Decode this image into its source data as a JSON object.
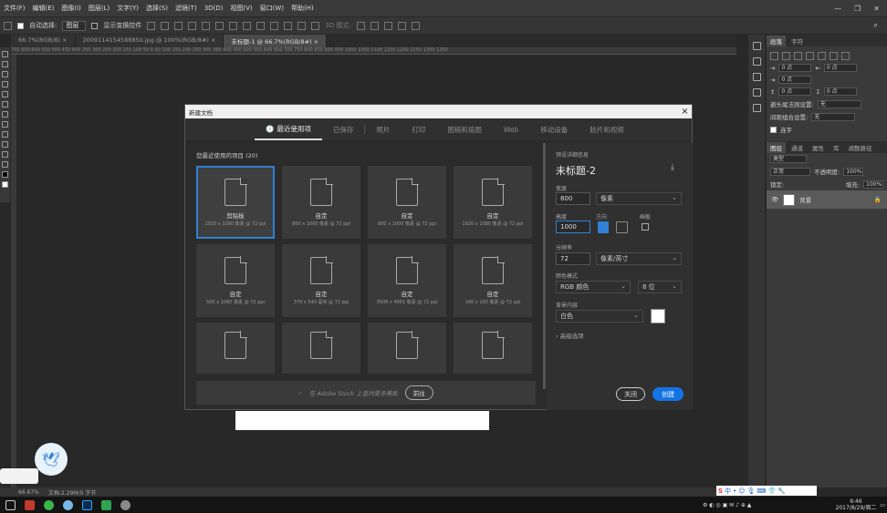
{
  "menu": [
    "文件(F)",
    "编辑(E)",
    "图像(I)",
    "图层(L)",
    "文字(Y)",
    "选择(S)",
    "滤镜(T)",
    "3D(D)",
    "视图(V)",
    "窗口(W)",
    "帮助(H)"
  ],
  "options": {
    "auto_select": "自动选择:",
    "layer_select": "图层",
    "show_transform": "显示变换控件",
    "mode3d": "3D 模式:"
  },
  "doc_tabs": [
    "66.7%(RGB/8)  ×",
    "2009114154588850.jpg @ 100%(RGB/8#)  ×",
    "未标题-1 @ 66.7%(RGB/8#)  ×"
  ],
  "ruler_ticks": "700  650  600  550  500  450  400  350  300  250  200  150  100  50  0  50  100  150  200  250  300  350  400  450  500  550  600  650  700  750  800  850  900  950  1000  1050  1100  1150  1200  1250  1300  1350",
  "status": {
    "zoom": "66.67%",
    "doc": "文档:2.29M/0 字节"
  },
  "right_panel": {
    "tabs": [
      "段落",
      "字符"
    ],
    "indent_fields": [
      "0 点",
      "0 点",
      "0 点",
      "0 点",
      "0 点"
    ],
    "avoid_label": "避头尾法则设置:",
    "avoid_value": "无",
    "spacing_label": "间距组合设置:",
    "spacing_value": "无",
    "hyphen_label": "连字",
    "layer_tabs": [
      "图层",
      "通道",
      "属性",
      "库",
      "调整路径"
    ],
    "kind": "类型",
    "mode": "正常",
    "opacity_label": "不透明度:",
    "opacity": "100%",
    "lock_label": "锁定:",
    "fill_label": "填充:",
    "fill": "100%",
    "layer_name": "背景"
  },
  "dialog": {
    "title": "新建文档",
    "close": "×",
    "tabs": [
      "最近使用项",
      "已保存",
      "照片",
      "打印",
      "图稿和插图",
      "Web",
      "移动设备",
      "胶片和视频"
    ],
    "recent_label": "您最近使用的项目 (20)",
    "presets": [
      {
        "name": "剪贴板",
        "size": "1920 x 1080 像素 @ 72 ppi"
      },
      {
        "name": "自定",
        "size": "800 x 1000 像素 @ 72 ppi"
      },
      {
        "name": "自定",
        "size": "800 x 1000 像素 @ 72 ppi"
      },
      {
        "name": "自定",
        "size": "1920 x 1080 像素 @ 72 ppi"
      },
      {
        "name": "自定",
        "size": "500 x 1080 像素 @ 72 ppi"
      },
      {
        "name": "自定",
        "size": "379 x 540 毫米 @ 72 ppi"
      },
      {
        "name": "自定",
        "size": "3508 x 4961 像素 @ 72 ppi"
      },
      {
        "name": "自定",
        "size": "160 x 160 像素 @ 72 ppi"
      },
      {
        "name": "",
        "size": ""
      },
      {
        "name": "",
        "size": ""
      },
      {
        "name": "",
        "size": ""
      },
      {
        "name": "",
        "size": ""
      }
    ],
    "stock_placeholder": "在 Adobe Stock 上查找更多模板",
    "go_button": "前往",
    "detail": {
      "heading": "预设详细信息",
      "name": "未标题-2",
      "width_label": "宽度",
      "width": "800",
      "width_unit": "像素",
      "height_label": "高度",
      "height": "1000",
      "orientation_label": "方向",
      "artboard_label": "画板",
      "res_label": "分辨率",
      "res": "72",
      "res_unit": "像素/英寸",
      "color_label": "颜色模式",
      "color_mode": "RGB 颜色",
      "bit": "8 位",
      "bg_label": "背景内容",
      "bg": "白色",
      "advanced": "高级选项",
      "close_btn": "关闭",
      "create_btn": "创建"
    }
  },
  "clock": {
    "time": "9:46",
    "date": "2017/8/29/周二"
  },
  "ime": "中"
}
